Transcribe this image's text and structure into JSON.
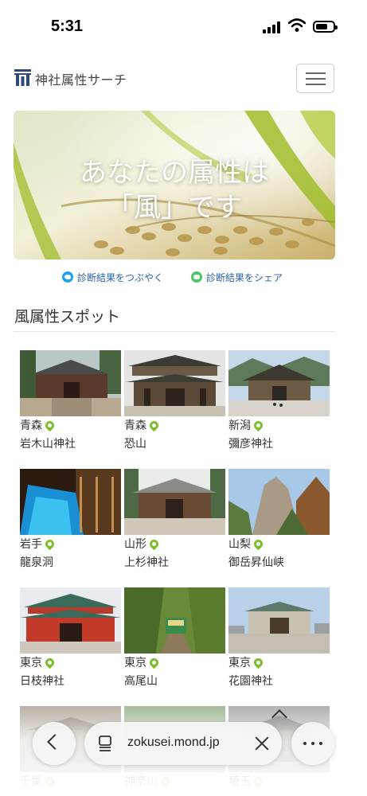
{
  "status_bar": {
    "time": "5:31"
  },
  "header": {
    "brand": "神社属性サーチ",
    "logo_icon": "torii-logo-icon",
    "menu_icon": "hamburger-menu-icon"
  },
  "hero": {
    "line1": "あなたの属性は",
    "line2": "「風」です"
  },
  "share": {
    "twitter_label": "診断結果をつぶやく",
    "line_label": "診断結果をシェア"
  },
  "section": {
    "title": "風属性スポット"
  },
  "spots": [
    {
      "pref": "青森",
      "name": "岩木山神社"
    },
    {
      "pref": "青森",
      "name": "恐山"
    },
    {
      "pref": "新潟",
      "name": "彌彦神社"
    },
    {
      "pref": "岩手",
      "name": "龍泉洞"
    },
    {
      "pref": "山形",
      "name": "上杉神社"
    },
    {
      "pref": "山梨",
      "name": "御岳昇仙峡"
    },
    {
      "pref": "東京",
      "name": "日枝神社"
    },
    {
      "pref": "東京",
      "name": "高尾山"
    },
    {
      "pref": "東京",
      "name": "花園神社"
    },
    {
      "pref": "千葉",
      "name": ""
    },
    {
      "pref": "神奈川",
      "name": ""
    },
    {
      "pref": "埼玉",
      "name": ""
    }
  ],
  "browser": {
    "url": "zokusei.mond.jp"
  }
}
